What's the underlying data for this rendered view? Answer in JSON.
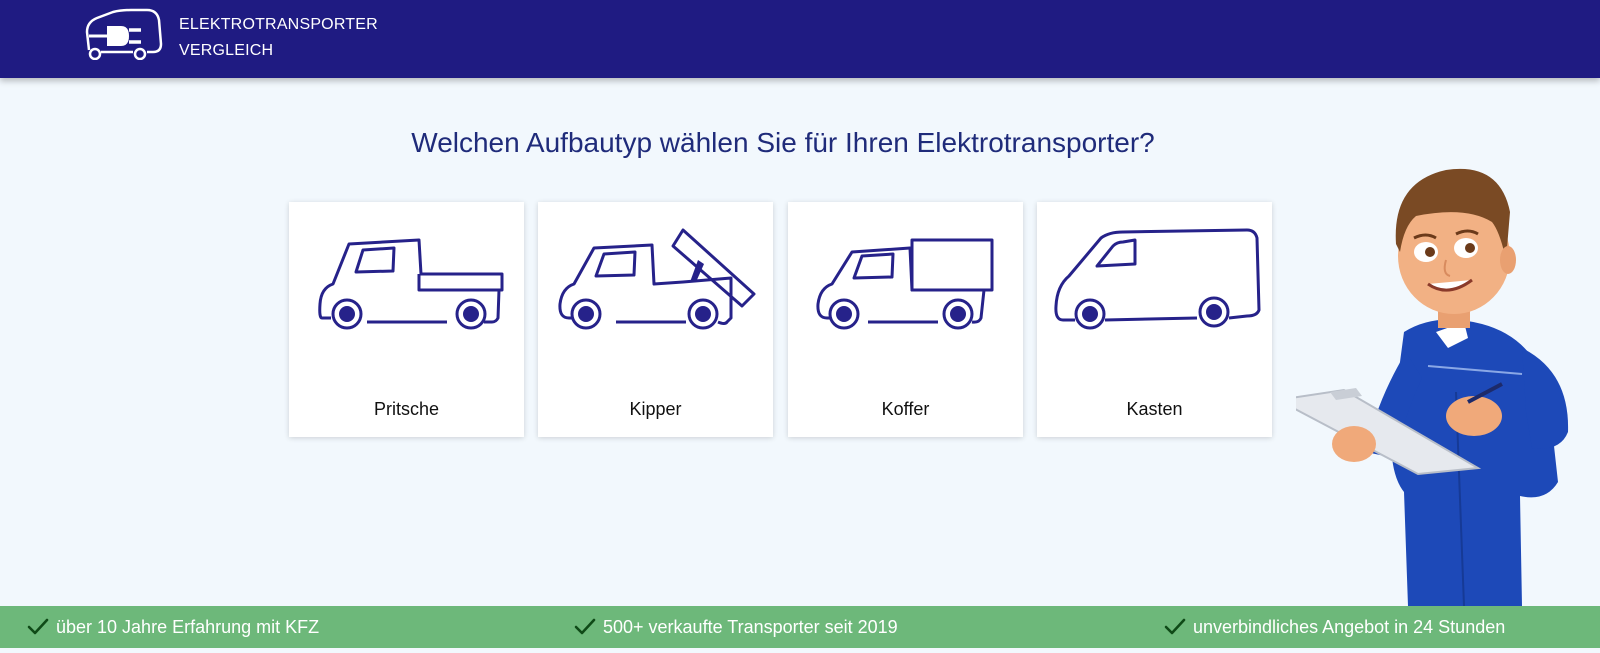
{
  "brand": {
    "logo_line1": "ELEKTROTRANSPORTER",
    "logo_line2": "VERGLEICH",
    "logo_icon": "electric-plug-van-icon"
  },
  "main": {
    "question": "Welchen Aufbautyp wählen Sie für Ihren Elektrotransporter?",
    "options": [
      {
        "label": "Pritsche",
        "icon": "flatbed-truck-icon"
      },
      {
        "label": "Kipper",
        "icon": "tipper-truck-icon"
      },
      {
        "label": "Koffer",
        "icon": "box-truck-icon"
      },
      {
        "label": "Kasten",
        "icon": "panel-van-icon"
      }
    ]
  },
  "footer": {
    "benefits": [
      {
        "text": "über 10 Jahre Erfahrung mit KFZ",
        "icon": "check-icon"
      },
      {
        "text": "500+ verkaufte Transporter seit 2019",
        "icon": "check-icon"
      },
      {
        "text": "unverbindliches Angebot in 24 Stunden",
        "icon": "check-icon"
      }
    ]
  },
  "colors": {
    "header": "#1f1b82",
    "footer": "#6db87a",
    "icon_stroke": "#26228a",
    "background": "#f2f8fd",
    "heading": "#1f2b7a"
  }
}
